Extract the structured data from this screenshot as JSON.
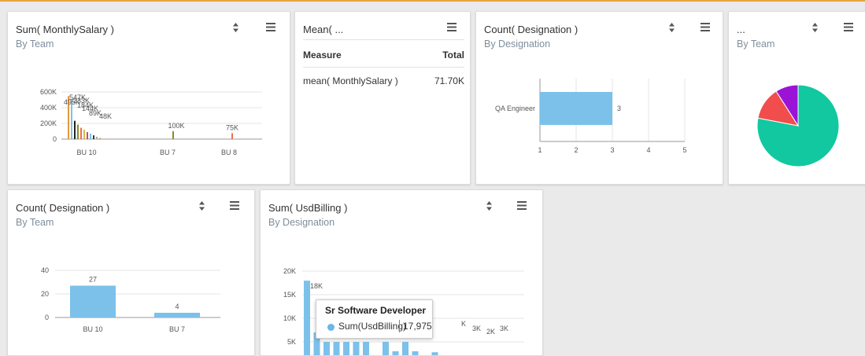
{
  "colors": {
    "accent_line": "#e8a33d",
    "bar_blue": "#7cc1ea",
    "label_blue": "#6ab7e8",
    "pie_teal": "#11c8a0",
    "pie_red": "#f24d4d",
    "pie_purple": "#9b14d6"
  },
  "widgets": [
    {
      "title": "Sum( MonthlySalary )",
      "subtitle": "By Team",
      "icons": [
        "sort-icon",
        "menu-icon"
      ],
      "chart_data": {
        "type": "bar",
        "categories": [
          "BU 10",
          "BU 7",
          "BU 8"
        ],
        "y_ticks": [
          "600K",
          "400K",
          "200K",
          "0"
        ],
        "ylim": [
          0,
          600000
        ],
        "overlapping_labels": [
          "547K",
          "495K",
          "233K",
          "184K",
          "144K",
          "89K",
          "48K"
        ],
        "value_labels": [
          "100K",
          "75K"
        ],
        "values_by_category": [
          547000,
          100000,
          75000
        ]
      }
    },
    {
      "title": "Mean( ...",
      "icons": [
        "menu-icon"
      ],
      "table": {
        "headers": [
          "Measure",
          "Total"
        ],
        "rows": [
          [
            "mean( MonthlySalary )",
            "71.70K"
          ]
        ]
      }
    },
    {
      "title": "Count( Designation )",
      "subtitle": "By Designation",
      "icons": [
        "sort-icon",
        "menu-icon"
      ],
      "chart_data": {
        "type": "bar",
        "orientation": "horizontal",
        "categories": [
          "QA Engineer"
        ],
        "values": [
          3
        ],
        "x_ticks": [
          "1",
          "2",
          "3",
          "4",
          "5"
        ],
        "xlim": [
          1,
          5
        ]
      }
    },
    {
      "title": "...",
      "subtitle": "By Team",
      "icons": [
        "sort-icon",
        "menu-icon"
      ],
      "chart_data": {
        "type": "pie",
        "slices": [
          {
            "value": 78,
            "color": "#11c8a0"
          },
          {
            "value": 13,
            "color": "#f24d4d"
          },
          {
            "value": 9,
            "color": "#9b14d6"
          }
        ]
      }
    },
    {
      "title": "Count( Designation )",
      "subtitle": "By Team",
      "icons": [
        "sort-icon",
        "menu-icon"
      ],
      "chart_data": {
        "type": "bar",
        "categories": [
          "BU 10",
          "BU 7"
        ],
        "values": [
          27,
          4
        ],
        "y_ticks": [
          "40",
          "20",
          "0"
        ],
        "ylim": [
          0,
          40
        ]
      }
    },
    {
      "title": "Sum( UsdBilling )",
      "subtitle": "By Designation",
      "icons": [
        "sort-icon",
        "menu-icon"
      ],
      "chart_data": {
        "type": "bar",
        "y_ticks": [
          "20K",
          "15K",
          "10K",
          "5K"
        ],
        "ylim": [
          0,
          20000
        ],
        "values": [
          17975,
          7000,
          5000,
          5000,
          5000,
          5000,
          5000,
          2000,
          5000,
          3000,
          5000,
          3000,
          1800,
          2800
        ],
        "value_labels": [
          "18K",
          "7",
          "K",
          "3K",
          "2K",
          "3K"
        ],
        "tooltip": {
          "title": "Sr Software Developer",
          "series": "Sum(UsdBilling)",
          "value": "17,975"
        }
      }
    }
  ]
}
